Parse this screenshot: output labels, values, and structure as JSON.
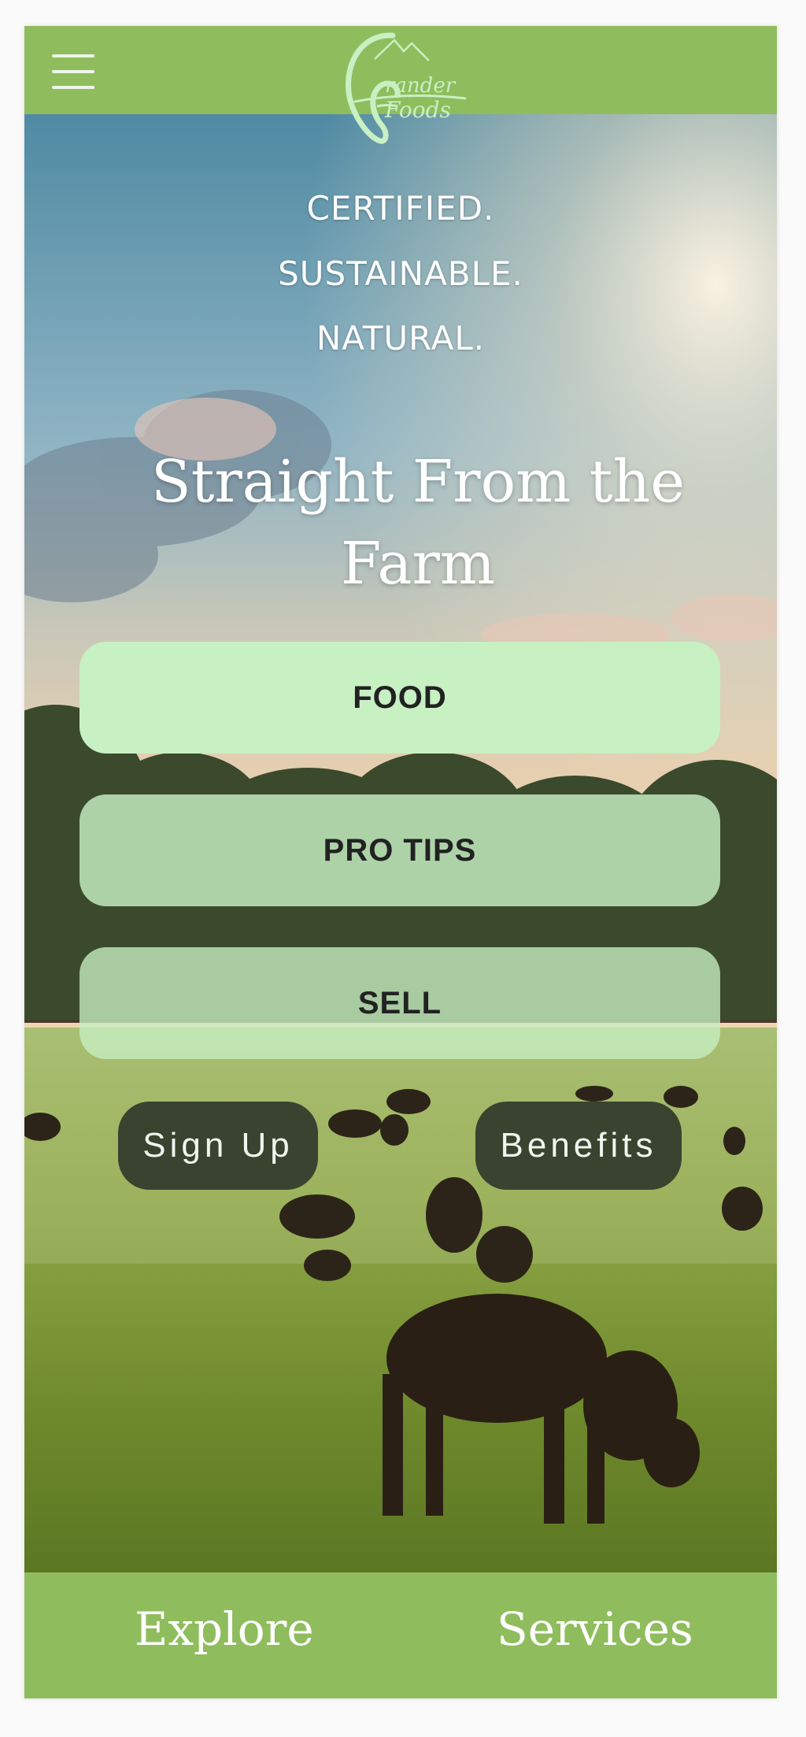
{
  "header": {
    "menu_icon": "hamburger-menu-icon",
    "logo_text": "Grander Foods",
    "bar_color": "#8fbd5d"
  },
  "hero": {
    "tagline_lines": [
      "CERTIFIED.",
      "SUSTAINABLE.",
      "NATURAL."
    ],
    "headline_line1": "Straight From the",
    "headline_line2": "Farm"
  },
  "nav_buttons": {
    "food": "FOOD",
    "pro_tips": "PRO TIPS",
    "sell": "SELL",
    "color": "#c7f0c3"
  },
  "actions": {
    "sign_up": "Sign Up",
    "benefits": "Benefits",
    "color": "#39432f"
  },
  "footer": {
    "explore": "Explore",
    "services": "Services"
  }
}
